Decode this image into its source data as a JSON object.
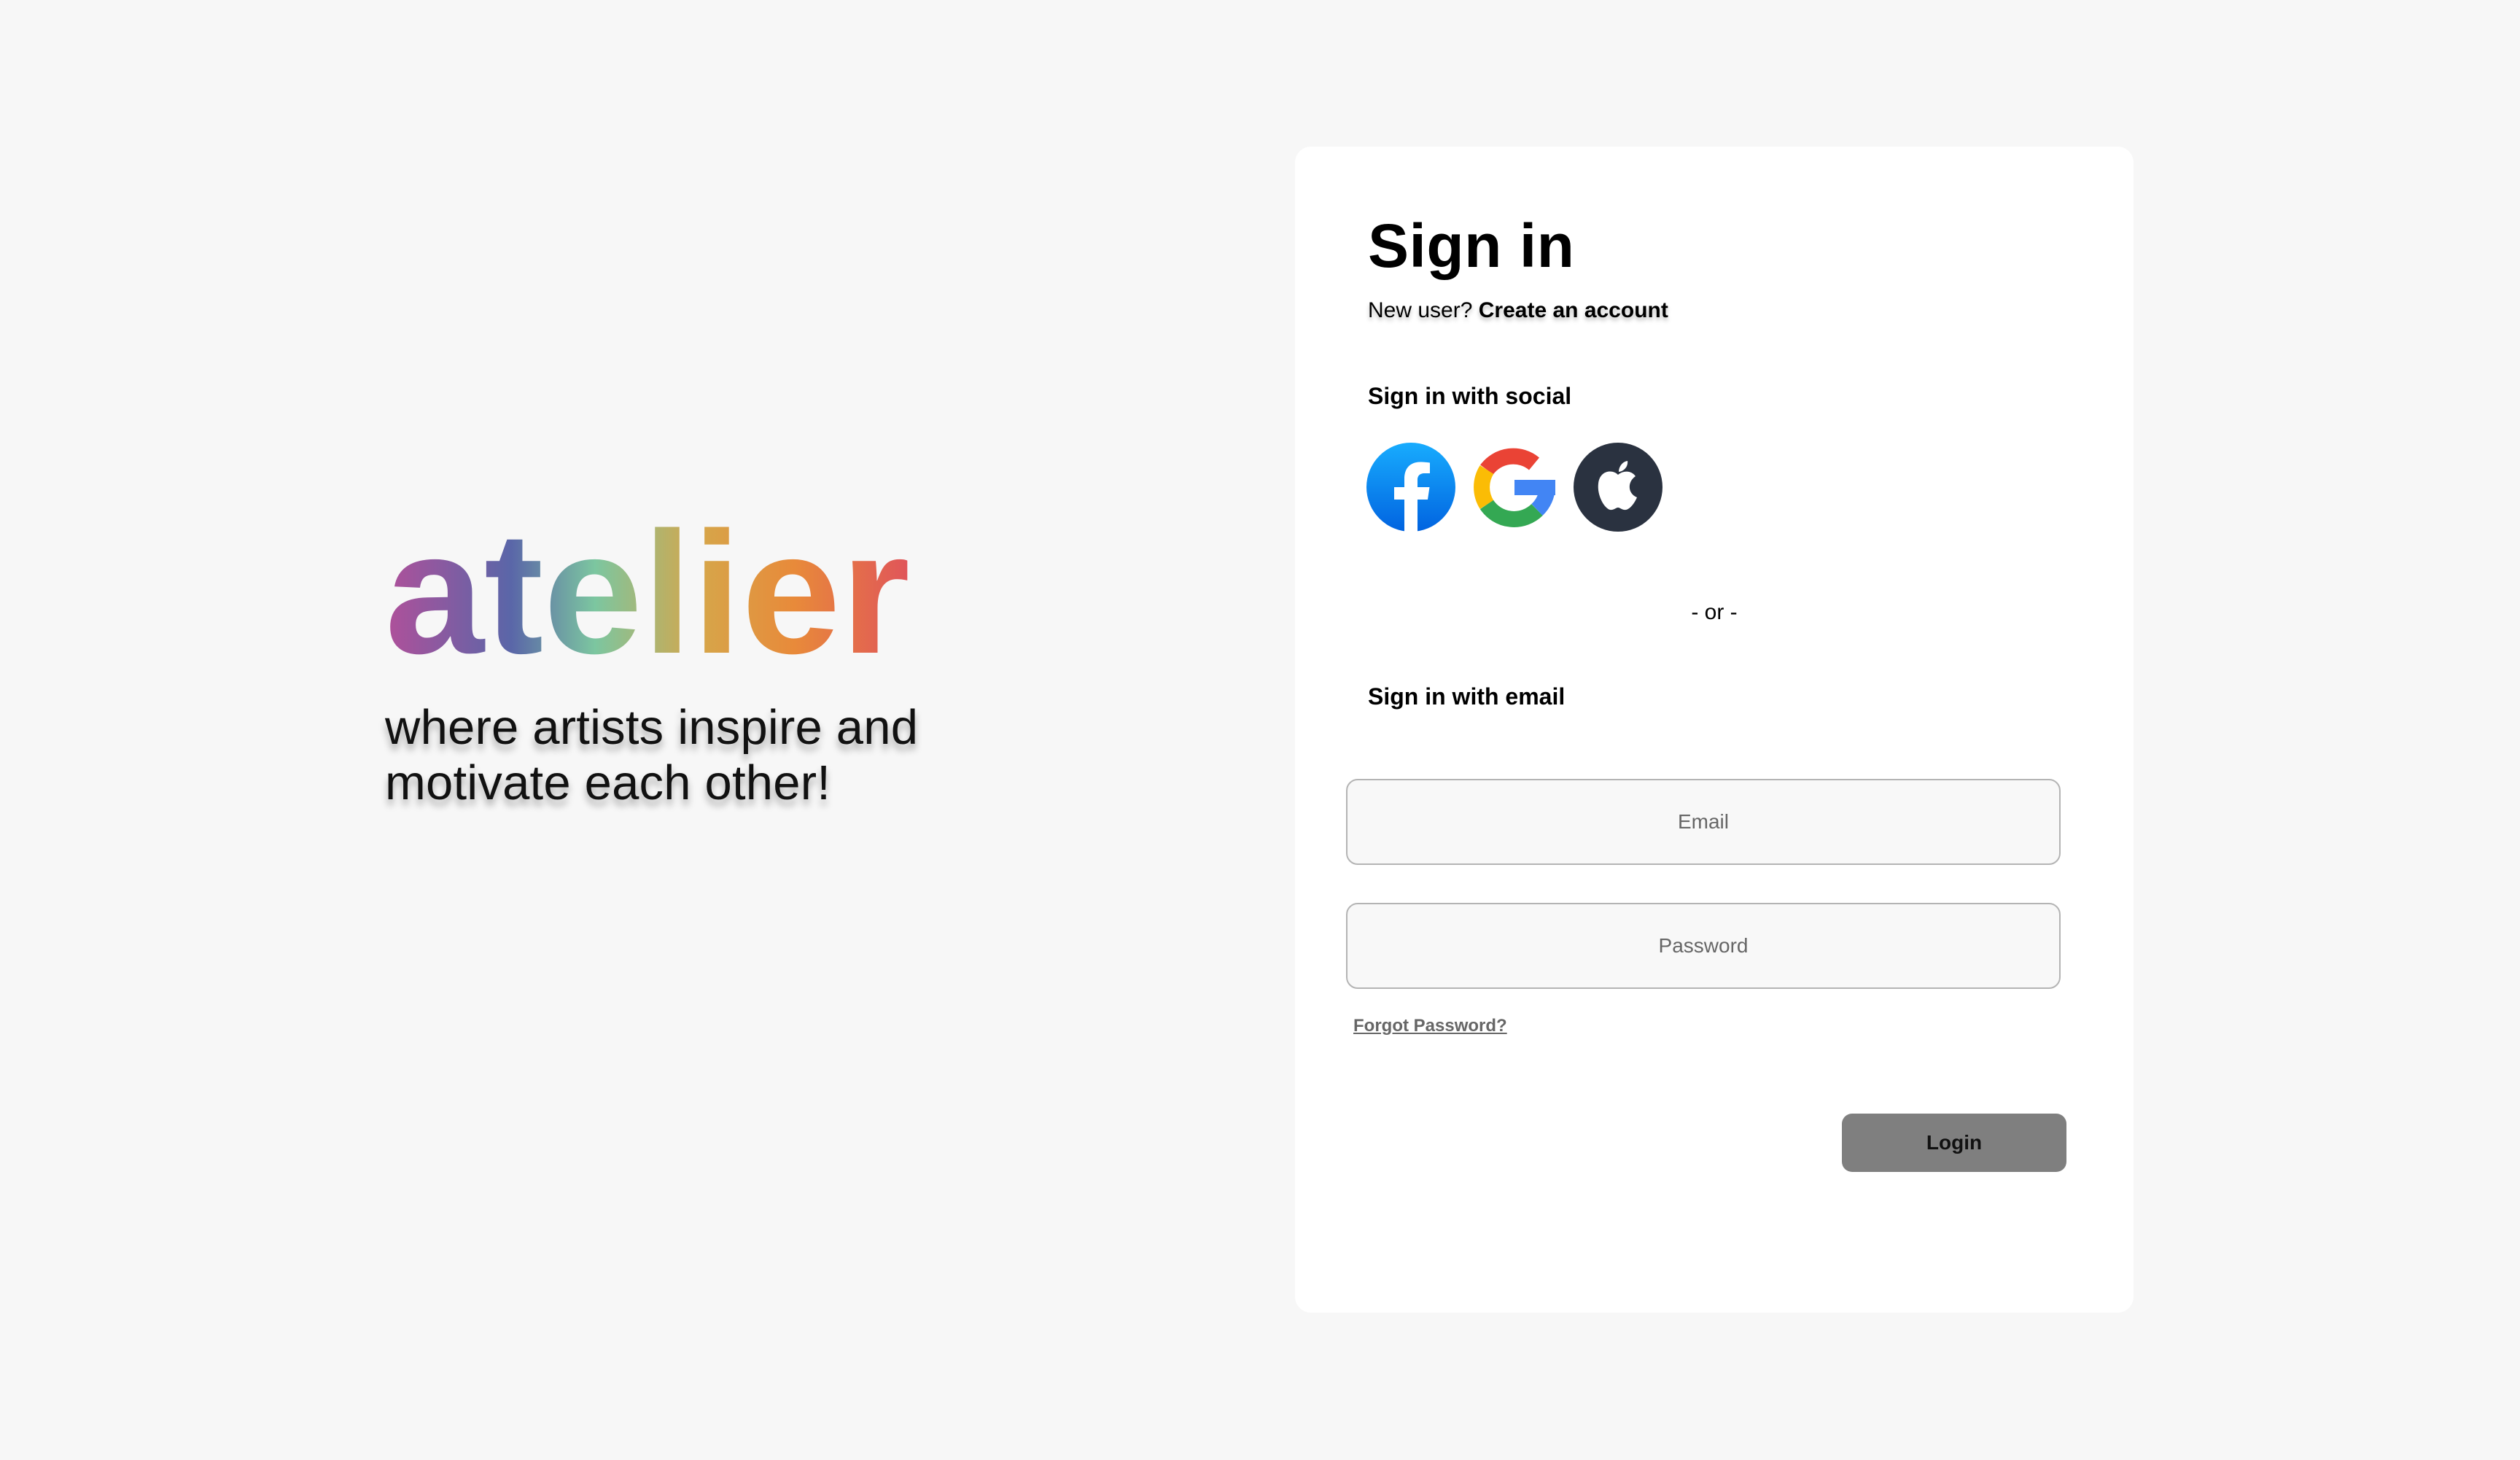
{
  "brand": {
    "logo_text": "atelier",
    "tagline_line1": "where artists inspire and",
    "tagline_line2": "motivate each other!"
  },
  "signin": {
    "title": "Sign in",
    "new_user_prompt": "New user?",
    "create_account_link": "Create an account",
    "social_label": "Sign in with social",
    "social_buttons": [
      {
        "icon": "facebook-icon",
        "color": "#1877f2"
      },
      {
        "icon": "google-icon",
        "color": "#4285f4"
      },
      {
        "icon": "apple-icon",
        "color": "#2a3240"
      }
    ],
    "divider": "- or -",
    "email_label": "Sign in with email",
    "email_placeholder": "Email",
    "password_placeholder": "Password",
    "forgot_password": "Forgot Password?",
    "login_button": "Login"
  },
  "colors": {
    "page_background": "#f7f7f7",
    "card_background": "#ffffff",
    "login_button": "#7f7f7f",
    "logo_gradient": [
      "#b0509a",
      "#5a66a8",
      "#7cc6a0",
      "#d6a64a",
      "#e88a3a",
      "#e0545a"
    ]
  }
}
